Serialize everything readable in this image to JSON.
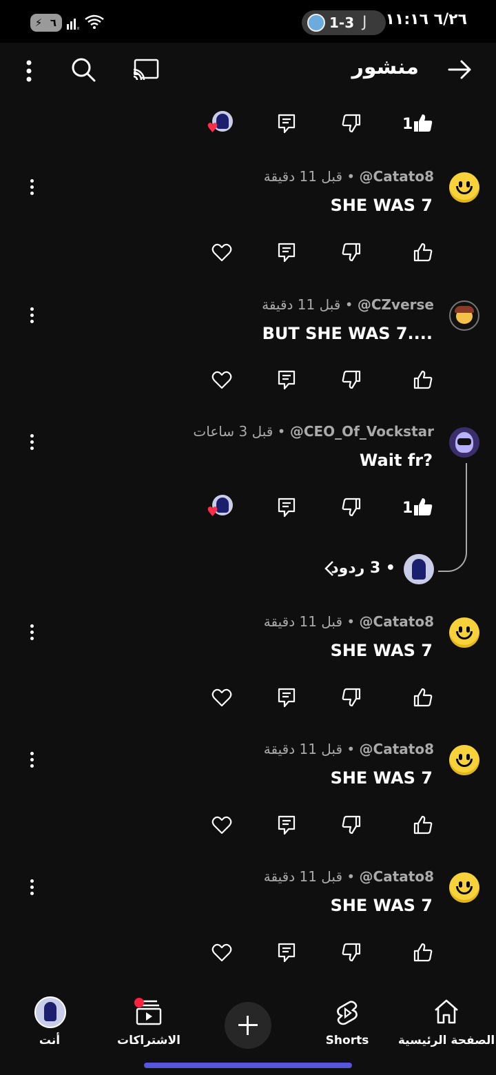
{
  "status_bar": {
    "time": "٦/٢٦  ١١:١٦",
    "score": "1-3",
    "battery": "٦"
  },
  "header": {
    "title": "منشور",
    "back_icon": "arrow-right-icon",
    "cast_icon": "cast-icon",
    "search_icon": "search-icon",
    "menu_icon": "more-vert-icon"
  },
  "post_actions": {
    "like_count": "1"
  },
  "comments": [
    {
      "author": "@Catato8",
      "time": "قبل 11 دقيقة",
      "text": "SHE WAS 7"
    },
    {
      "author": "@CZverse",
      "time": "قبل 11 دقيقة",
      "text": "BUT SHE WAS 7...."
    },
    {
      "author": "@CEO_Of_Vockstar",
      "time": "قبل 3 ساعات",
      "text": "Wait fr?",
      "like_count": "1",
      "replies": "3 ردود"
    },
    {
      "author": "@Catato8",
      "time": "قبل 11 دقيقة",
      "text": "SHE WAS 7"
    },
    {
      "author": "@Catato8",
      "time": "قبل 11 دقيقة",
      "text": "SHE WAS 7"
    },
    {
      "author": "@Catato8",
      "time": "قبل 11 دقيقة",
      "text": "SHE WAS 7"
    }
  ],
  "nav": {
    "home": "الصفحة الرئيسية",
    "shorts": "Shorts",
    "subscriptions": "الاشتراكات",
    "you": "أنت"
  },
  "colors": {
    "background": "#0f0f0f",
    "accent": "#5754e0",
    "notification": "#ff2140"
  }
}
